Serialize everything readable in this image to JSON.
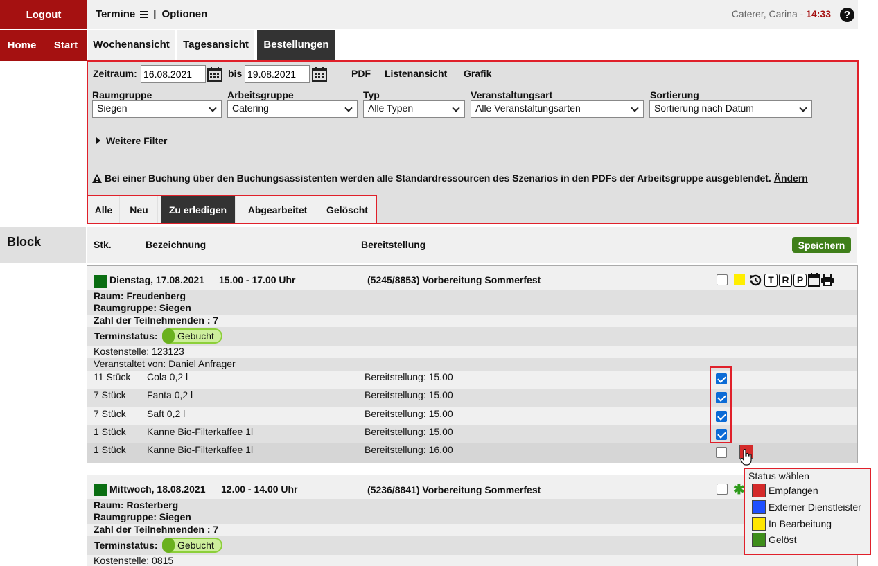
{
  "top": {
    "logout": "Logout",
    "menu": "Termine",
    "separator": "|",
    "options": "Optionen",
    "user": "Caterer, Carina -",
    "time": "14:33",
    "help": "?"
  },
  "nav": {
    "home": "Home",
    "start": "Start",
    "tabs": [
      "Wochenansicht",
      "Tagesansicht",
      "Bestellungen"
    ]
  },
  "filter": {
    "zeitraum_label": "Zeitraum:",
    "date_from": "16.08.2021",
    "bis_label": "bis",
    "date_to": "19.08.2021",
    "links": [
      "PDF",
      "Listenansicht",
      "Grafik"
    ],
    "selects": [
      {
        "label": "Raumgruppe",
        "value": "Siegen"
      },
      {
        "label": "Arbeitsgruppe",
        "value": "Catering"
      },
      {
        "label": "Typ",
        "value": "Alle Typen"
      },
      {
        "label": "Veranstaltungsart",
        "value": "Alle Veranstaltungsarten"
      },
      {
        "label": "Sortierung",
        "value": "Sortierung nach Datum"
      }
    ],
    "more_filters": "Weitere Filter",
    "warning": "Bei einer Buchung über den Buchungsassistenten werden alle Standardressourcen des Szenarios in den PDFs der Arbeitsgruppe ausgeblendet.",
    "warning_link": "Ändern"
  },
  "subtabs": [
    "Alle",
    "Neu",
    "Zu erledigen",
    "Abgearbeitet",
    "Gelöscht"
  ],
  "block_label": "Block",
  "columns": {
    "qty": "Stk.",
    "name": "Bezeichnung",
    "time": "Bereitstellung",
    "save": "Speichern"
  },
  "card1": {
    "date": "Dienstag, 17.08.2021",
    "time": "15.00 - 17.00 Uhr",
    "title": "(5245/8853) Vorbereitung Sommerfest",
    "room": "Raum: Freudenberg",
    "roomgroup": "Raumgruppe: Siegen",
    "participants": "Zahl der Teilnehmenden : 7",
    "status_label": "Terminstatus:",
    "status": "Gebucht",
    "cost_center": "Kostenstelle: 123123",
    "organizer": "Veranstaltet von: Daniel Anfrager",
    "items": [
      {
        "qty": "11 Stück",
        "name": "Cola 0,2 l",
        "time": "Bereitstellung: 15.00"
      },
      {
        "qty": "7 Stück",
        "name": "Fanta 0,2 l",
        "time": "Bereitstellung: 15.00"
      },
      {
        "qty": "7 Stück",
        "name": "Saft 0,2 l",
        "time": "Bereitstellung: 15.00"
      },
      {
        "qty": "1 Stück",
        "name": "Kanne Bio-Filterkaffee 1l",
        "time": "Bereitstellung: 15.00"
      },
      {
        "qty": "1 Stück",
        "name": "Kanne Bio-Filterkaffee 1l",
        "time": "Bereitstellung: 16.00"
      }
    ],
    "icons": [
      "T",
      "R",
      "P"
    ]
  },
  "card2": {
    "date": "Mittwoch, 18.08.2021",
    "time": "12.00 - 14.00 Uhr",
    "title": "(5236/8841) Vorbereitung Sommerfest",
    "room": "Raum: Rosterberg",
    "roomgroup": "Raumgruppe: Siegen",
    "participants": "Zahl der Teilnehmenden : 7",
    "status_label": "Terminstatus:",
    "status": "Gebucht",
    "cost_center": "Kostenstelle: 0815"
  },
  "popup": {
    "title": "Status wählen",
    "options": [
      {
        "label": "Empfangen",
        "color": "#d42a2a"
      },
      {
        "label": "Externer Dienstleister",
        "color": "#1e4fff"
      },
      {
        "label": "In Bearbeitung",
        "color": "#ffe600"
      },
      {
        "label": "Gelöst",
        "color": "#3e8d1a"
      }
    ]
  },
  "colors": {
    "brand": "#a51111",
    "highlight": "#e0202a",
    "accent": "#0b6bd6"
  }
}
